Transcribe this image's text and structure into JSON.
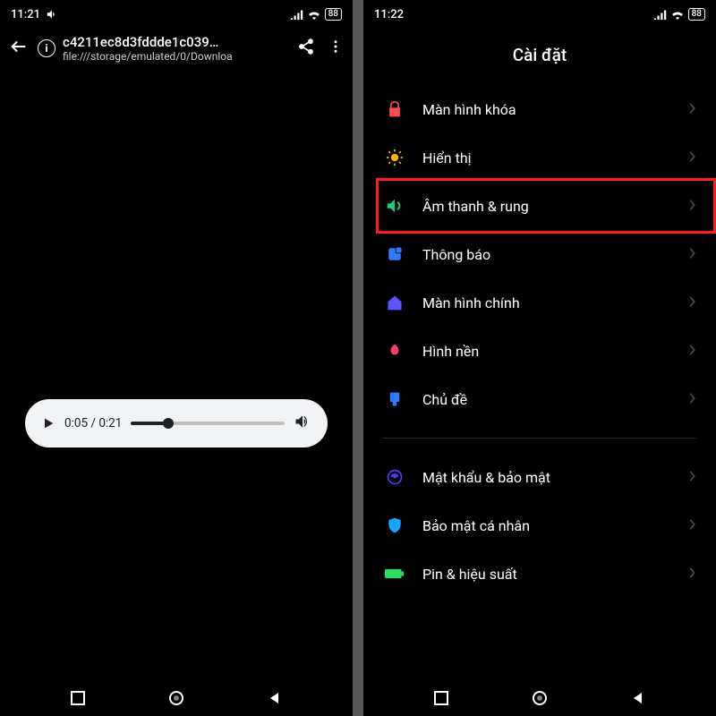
{
  "left": {
    "status": {
      "time": "11:21",
      "battery": "88"
    },
    "browser": {
      "title": "c4211ec8d3fddde1c039…",
      "subtitle": "file:///storage/emulated/0/Downloa"
    },
    "player": {
      "current": "0:05",
      "duration": "0:21",
      "progress_pct": 24
    }
  },
  "right": {
    "status": {
      "time": "11:22",
      "battery": "88"
    },
    "title": "Cài đặt",
    "items": [
      {
        "id": "lockscreen",
        "label": "Màn hình khóa",
        "color": "#ff4d4d"
      },
      {
        "id": "display",
        "label": "Hiển thị",
        "color": "#ffb300"
      },
      {
        "id": "sound",
        "label": "Âm thanh & rung",
        "color": "#1ec97e",
        "highlighted": true
      },
      {
        "id": "notify",
        "label": "Thông báo",
        "color": "#2f7bff"
      },
      {
        "id": "home",
        "label": "Màn hình chính",
        "color": "#5a55ff"
      },
      {
        "id": "wallpaper",
        "label": "Hình nền",
        "color": "#ff3b6b"
      },
      {
        "id": "themes",
        "label": "Chủ đề",
        "color": "#2f7bff"
      }
    ],
    "items2": [
      {
        "id": "security",
        "label": "Mật khẩu & bảo mật",
        "color": "#4c3bff"
      },
      {
        "id": "privacy",
        "label": "Bảo mật cá nhân",
        "color": "#18a4ff"
      },
      {
        "id": "battery",
        "label": "Pin & hiệu suất",
        "color": "#2bdc65"
      }
    ]
  }
}
